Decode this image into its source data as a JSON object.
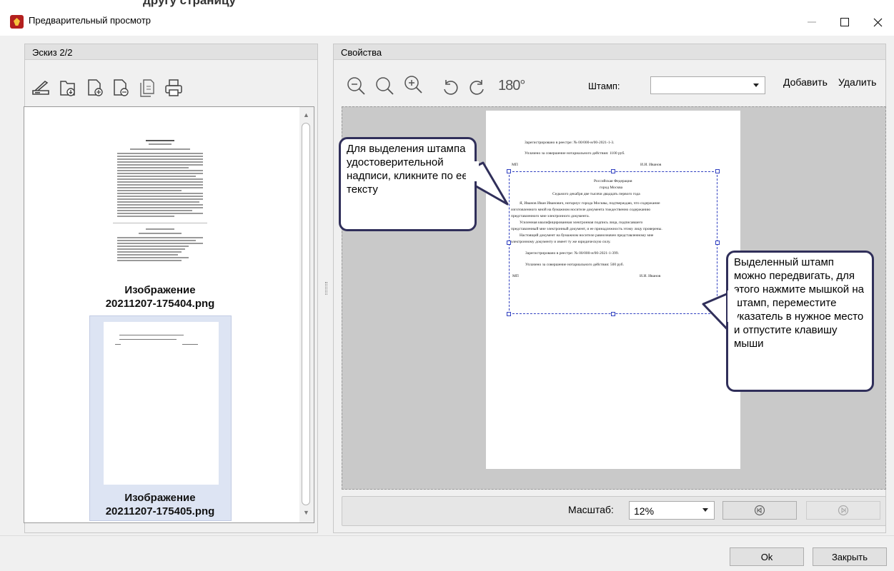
{
  "window": {
    "title": "Предварительный просмотр",
    "top_cut_text": "другу страницу"
  },
  "left_panel": {
    "title": "Эскиз 2/2",
    "toolbar_icons": [
      "scanner-icon",
      "folder-import-icon",
      "page-add-icon",
      "page-remove-icon",
      "page-copy-icon",
      "print-icon"
    ],
    "thumbnails": [
      {
        "label_line1": "Изображение",
        "label_line2": "20211207-175404.png"
      },
      {
        "label_line1": "Изображение",
        "label_line2": "20211207-175405.png"
      }
    ]
  },
  "right_panel": {
    "title": "Свойства",
    "toolbar_icons": [
      "zoom-out-icon",
      "zoom-reset-icon",
      "zoom-in-icon",
      "rotate-left-icon",
      "rotate-right-icon",
      "rotate-180-icon"
    ],
    "rotate_180_label": "180°",
    "stamp_label": "Штамп:",
    "stamp_value": "",
    "add_label": "Добавить",
    "delete_label": "Удалить",
    "document": {
      "reg_line": "Зарегистрировано в реестре: № 00/000-н/00-2021-1-3.",
      "fee_line": "Уплачено за совершение нотариального действия: 1100 руб.",
      "mp": "МП",
      "signer": "И.И. Иванов",
      "stamp_head1": "Российская Федерация",
      "stamp_head2": "город Москва",
      "stamp_date": "Седьмого декабря две тысячи двадцать первого года",
      "stamp_p1": "Я, Иванов Иван Иванович, нотариус города Москвы, подтверждаю, что содержание",
      "stamp_p2": "изготовленного мной на бумажном носителе документа тождественно содержанию",
      "stamp_p3": "представленного мне электронного документа.",
      "stamp_p4": "Усиленная квалифицированная электронная подпись лица, подписавшего",
      "stamp_p5": "представленный мне электронный документ, и ее принадлежность этому лицу проверены.",
      "stamp_p6": "Настоящий документ на бумажном носителе равнозначен представленному мне",
      "stamp_p7": "электронному документу и имеет ту же юридическую силу.",
      "stamp_reg": "Зарегистрировано в реестре: № 00/000-н/00-2021-1-399.",
      "stamp_fee": "Уплачено за совершение нотариального действия: 500 руб.",
      "stamp_mp": "МП",
      "stamp_signer": "И.И. Иванов"
    },
    "callout_left": "Для выделения штампа удостоверительной надписи, кликните по ее тексту",
    "callout_right": "Выделенный штамп можно передвигать, для этого нажмите мышкой на штамп, переместите указатель в нужное место и отпустите клавишу мыши",
    "zoom_label": "Масштаб:",
    "zoom_value": "12%"
  },
  "footer": {
    "ok_label": "Ok",
    "close_label": "Закрыть"
  }
}
